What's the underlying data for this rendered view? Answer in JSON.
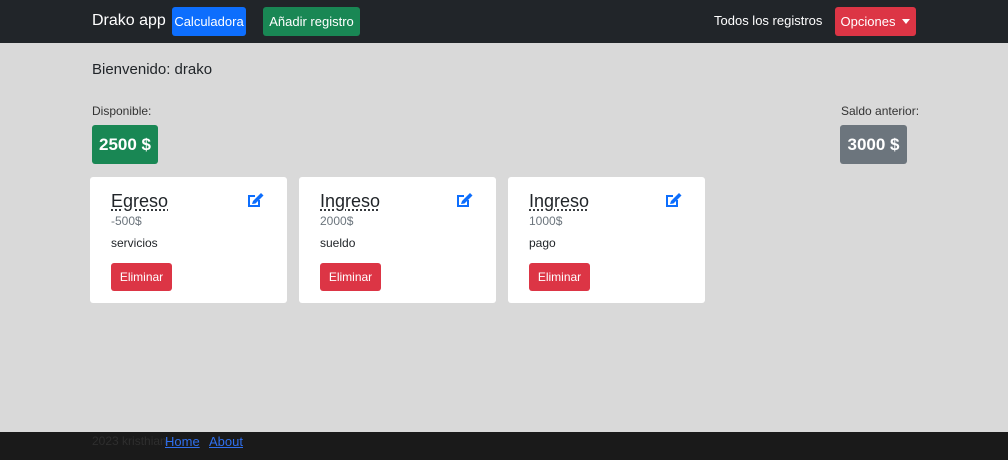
{
  "navbar": {
    "brand": "Drako app",
    "calculator_label": "Calculadora",
    "add_label": "Añadir registro",
    "all_records_label": "Todos los registros",
    "options_label": "Opciones"
  },
  "main": {
    "welcome": "Bienvenido: drako",
    "available_label": "Disponible:",
    "available_value": "2500 $",
    "previous_label": "Saldo anterior:",
    "previous_value": "3000 $"
  },
  "records": [
    {
      "type": "Egreso",
      "amount": "-500$",
      "description": "servicios",
      "delete_label": "Eliminar"
    },
    {
      "type": "Ingreso",
      "amount": "2000$",
      "description": "sueldo",
      "delete_label": "Eliminar"
    },
    {
      "type": "Ingreso",
      "amount": "1000$",
      "description": "pago",
      "delete_label": "Eliminar"
    }
  ],
  "footer": {
    "copyright": "2023 kristhian",
    "home_label": "Home",
    "about_label": "About"
  },
  "colors": {
    "navbar": "#212529",
    "primary": "#0d6efd",
    "success": "#198754",
    "danger": "#dc3545",
    "secondary": "#6c757d",
    "background": "#d9d9d9"
  },
  "icons": {
    "edit": "edit-icon",
    "caret": "caret-down-icon"
  }
}
